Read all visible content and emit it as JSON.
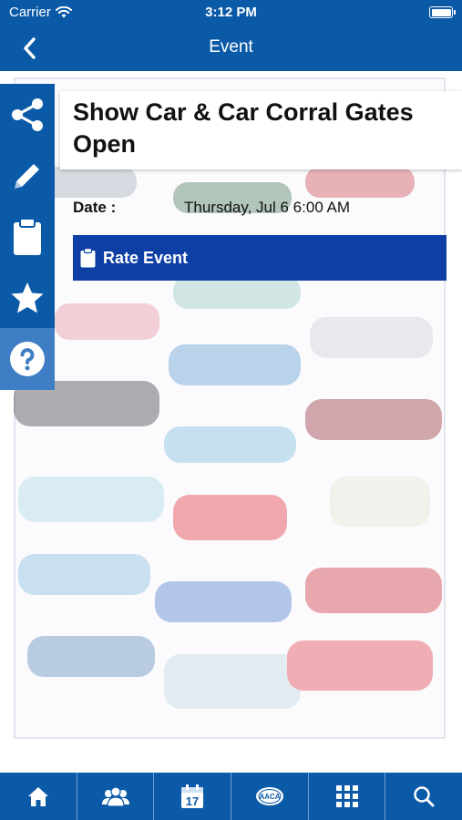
{
  "status_bar": {
    "carrier": "Carrier",
    "time": "3:12 PM"
  },
  "nav": {
    "title": "Event",
    "back_icon": "chevron-left-icon"
  },
  "event": {
    "title": "Show Car & Car Corral Gates Open",
    "date_label": "Date :",
    "date_value": "Thursday, Jul 6 6:00 AM",
    "rate_label": "Rate Event"
  },
  "sidebar": [
    {
      "icon": "share-icon"
    },
    {
      "icon": "pencil-icon"
    },
    {
      "icon": "clipboard-icon"
    },
    {
      "icon": "star-icon"
    },
    {
      "icon": "help-icon"
    }
  ],
  "tabs": [
    {
      "icon": "home-icon"
    },
    {
      "icon": "people-icon"
    },
    {
      "icon": "calendar-icon",
      "text": "17"
    },
    {
      "icon": "logo-icon",
      "text": "AACA"
    },
    {
      "icon": "grid-icon"
    },
    {
      "icon": "search-icon"
    }
  ],
  "colors": {
    "bar_blue": "#0b5aa8",
    "rate_button": "#0d3fa5",
    "help_blue": "#3f7ec4"
  }
}
